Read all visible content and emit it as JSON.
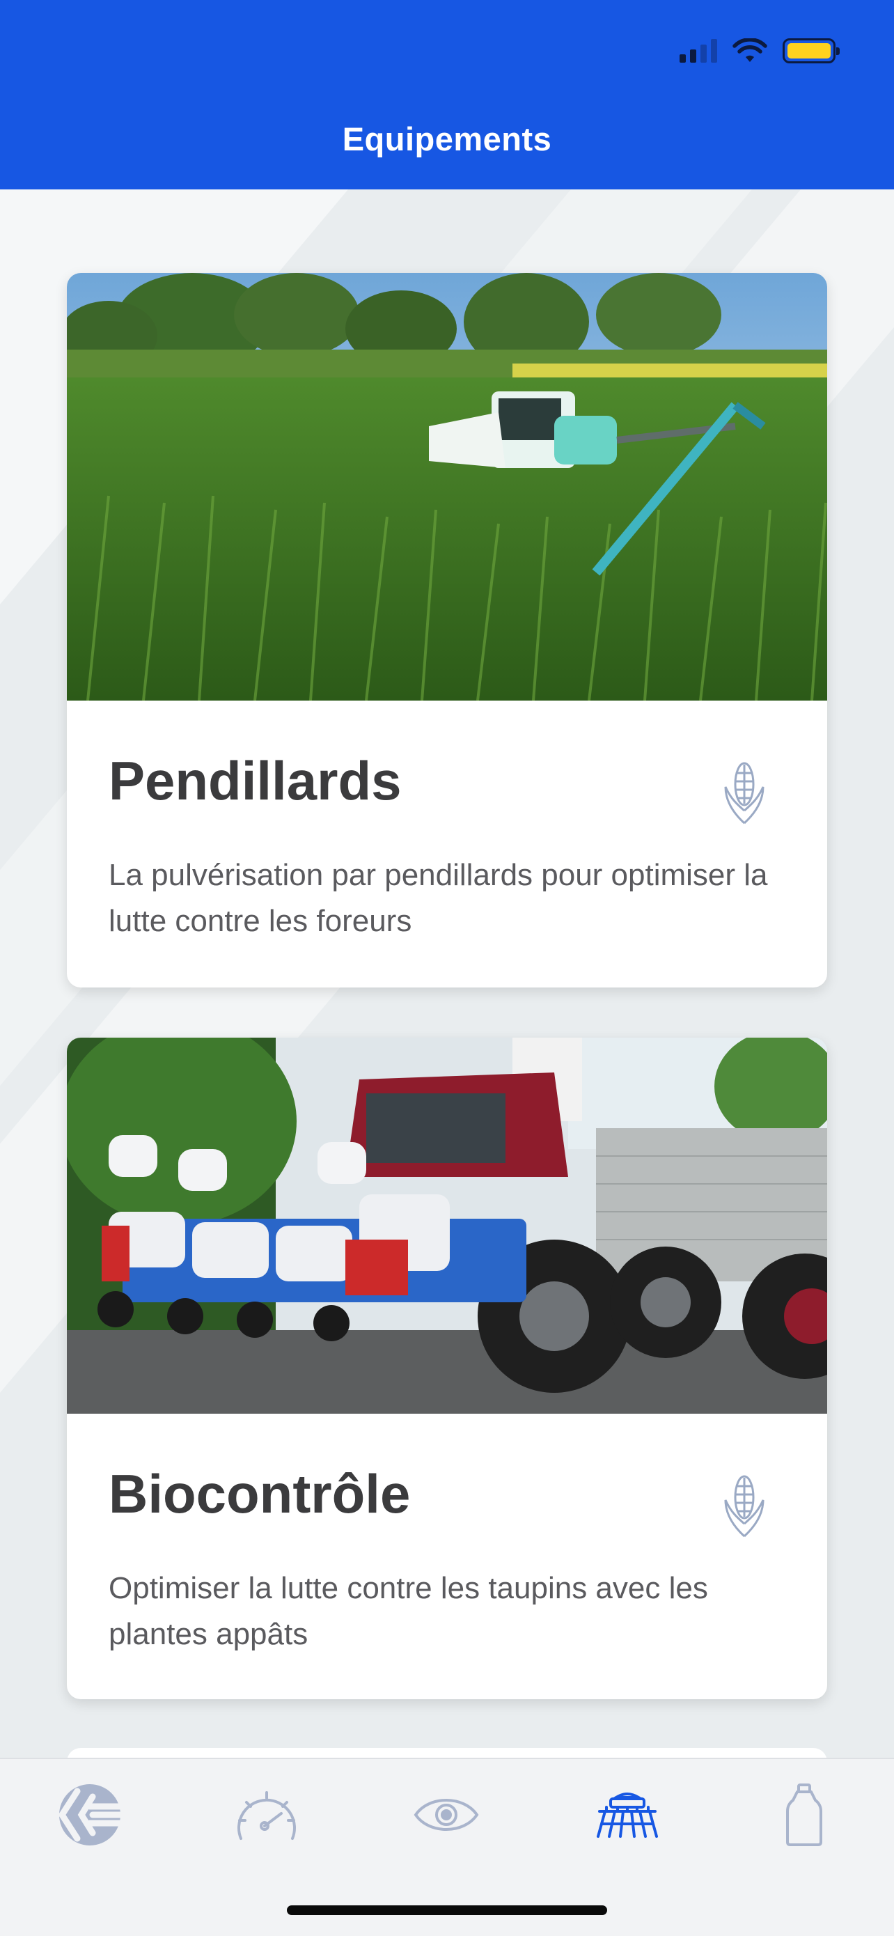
{
  "status_bar": {
    "signal_icon": "cellular-signal-icon",
    "wifi_icon": "wifi-icon",
    "battery_icon": "battery-icon",
    "battery_color": "#ffd21f"
  },
  "header": {
    "title": "Equipements",
    "background_color": "#1757e3"
  },
  "cards": [
    {
      "title": "Pendillards",
      "description": "La pulvérisation par pendillards pour optimiser la lutte contre les foreurs",
      "image": "sprayer-in-corn-field-photo",
      "icon": "corn-icon"
    },
    {
      "title": "Biocontrôle",
      "description": "Optimiser la lutte contre les taupins avec les plantes appâts",
      "image": "tractor-with-seeder-photo",
      "icon": "corn-icon"
    }
  ],
  "tab_bar": {
    "items": [
      {
        "icon": "brand-logo-icon",
        "active": false
      },
      {
        "icon": "speedometer-icon",
        "active": false
      },
      {
        "icon": "eye-icon",
        "active": false
      },
      {
        "icon": "seeder-machine-icon",
        "active": true
      },
      {
        "icon": "bottle-icon",
        "active": false
      }
    ],
    "active_color": "#1757e3",
    "inactive_color": "#a9b4cc"
  }
}
